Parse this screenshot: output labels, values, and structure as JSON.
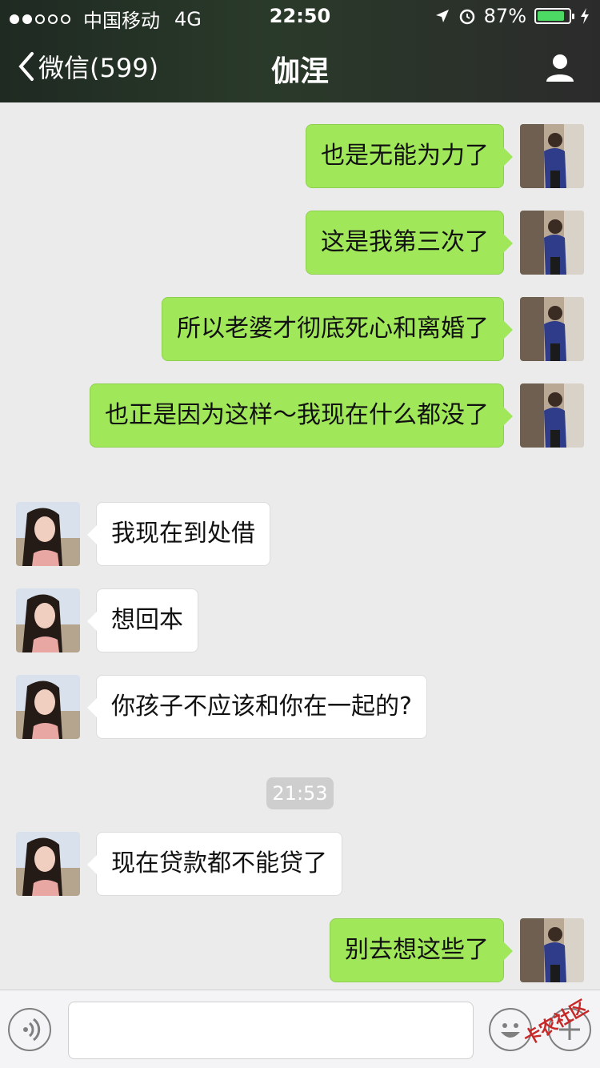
{
  "status_bar": {
    "carrier": "中国移动",
    "network": "4G",
    "time": "22:50",
    "battery_percent": "87%",
    "battery_level": 0.87
  },
  "nav": {
    "back_label": "微信(599)",
    "title": "伽涅"
  },
  "messages": [
    {
      "from": "me",
      "text": "也是无能为力了"
    },
    {
      "from": "me",
      "text": "这是我第三次了"
    },
    {
      "from": "me",
      "text": "所以老婆才彻底死心和离婚了"
    },
    {
      "from": "me",
      "text": "也正是因为这样～我现在什么都没了"
    },
    {
      "from": "them",
      "text": "我现在到处借"
    },
    {
      "from": "them",
      "text": "想回本"
    },
    {
      "from": "them",
      "text": "你孩子不应该和你在一起的?"
    },
    {
      "from": "them",
      "text": "现在贷款都不能贷了"
    },
    {
      "from": "me",
      "text": "别去想这些了"
    }
  ],
  "timestamp": "21:53",
  "watermark": "卡农社区",
  "colors": {
    "my_bubble": "#a0e75a",
    "their_bubble": "#ffffff",
    "background": "#ebebeb"
  }
}
